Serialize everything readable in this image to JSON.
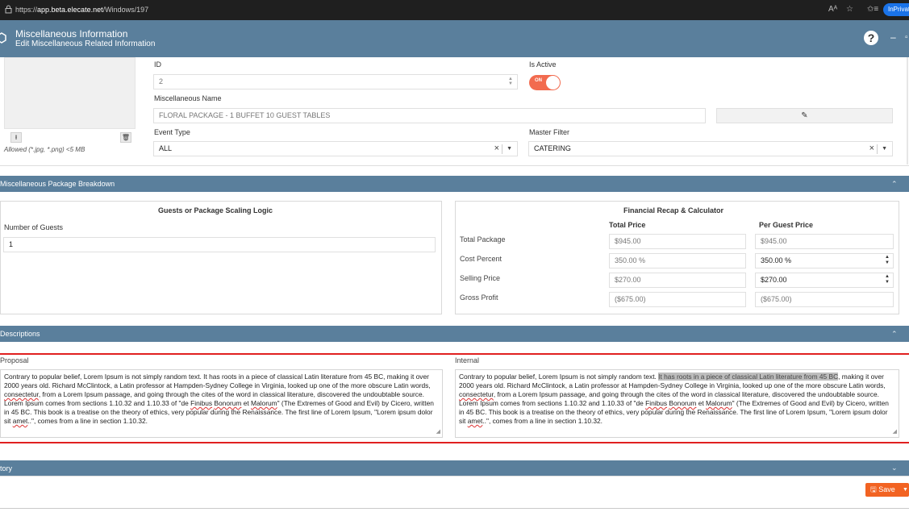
{
  "browser": {
    "url_prefix": "https://",
    "url_host": "app.beta.elecate.net",
    "url_path": "/Windows/197",
    "inprivate_label": "InPrivat"
  },
  "header": {
    "title": "Miscellaneous Information",
    "subtitle": "Edit Miscellaneous Related Information",
    "help_label": "?",
    "minimize_label": "–",
    "maximize_label": "▫"
  },
  "form": {
    "id_label": "ID",
    "id_value": "2",
    "is_active_label": "Is Active",
    "toggle_text": "ON",
    "name_label": "Miscellaneous Name",
    "name_value": "FLORAL PACKAGE - 1 BUFFET 10 GUEST TABLES",
    "event_type_label": "Event Type",
    "event_type_value": "ALL",
    "master_filter_label": "Master Filter",
    "master_filter_value": "CATERING",
    "allowed_note": "Allowed (*.jpg, *.png) <5 MB"
  },
  "breakdown": {
    "section_title": "Miscellaneous Package Breakdown",
    "scaling_title": "Guests or Package Scaling Logic",
    "guests_label": "Number of Guests",
    "guests_value": "1",
    "fin_title": "Financial Recap & Calculator",
    "col_total": "Total Price",
    "col_per_guest": "Per Guest Price",
    "rows": [
      {
        "label": "Total Package",
        "total": "$945.00",
        "per_guest": "$945.00"
      },
      {
        "label": "Cost Percent",
        "total": "350.00 %",
        "per_guest": "350.00 %"
      },
      {
        "label": "Selling Price",
        "total": "$270.00",
        "per_guest": "$270.00"
      },
      {
        "label": "Gross Profit",
        "total": "($675.00)",
        "per_guest": "($675.00)"
      }
    ]
  },
  "descriptions": {
    "section_title": "Descriptions",
    "proposal_label": "Proposal",
    "internal_label": "Internal",
    "text_part1": "Contrary to popular belief, Lorem Ipsum is not simply random text. ",
    "text_part2": "It has roots in a piece of classical Latin literature from 45 BC",
    "text_part3": ", making it over 2000 years old. Richard McClintock, a Latin professor at Hampden-Sydney College in Virginia, looked up one of the more obscure Latin words, ",
    "text_part4": "consectetur",
    "text_part5": ", from a Lorem Ipsum passage, and going through the cites of the word in classical literature, discovered the undoubtable source. Lorem Ipsum comes from sections 1.10.32 and 1.10.33 of \"de ",
    "text_part6": "Finibus",
    "text_part7": " ",
    "text_part8": "Bonorum",
    "text_part9": " et ",
    "text_part10": "Malorum",
    "text_part11": "\" (The Extremes of Good and Evil) by Cicero, written in 45 BC. This book is a treatise on the theory of ethics, very popular during the Renaissance. The first line of Lorem Ipsum, \"Lorem ipsum dolor sit ",
    "text_part12": "amet",
    "text_part13": "..\", comes from a line in section 1.10.32."
  },
  "history": {
    "section_title": "tory"
  },
  "footer": {
    "save_label": "Save"
  }
}
